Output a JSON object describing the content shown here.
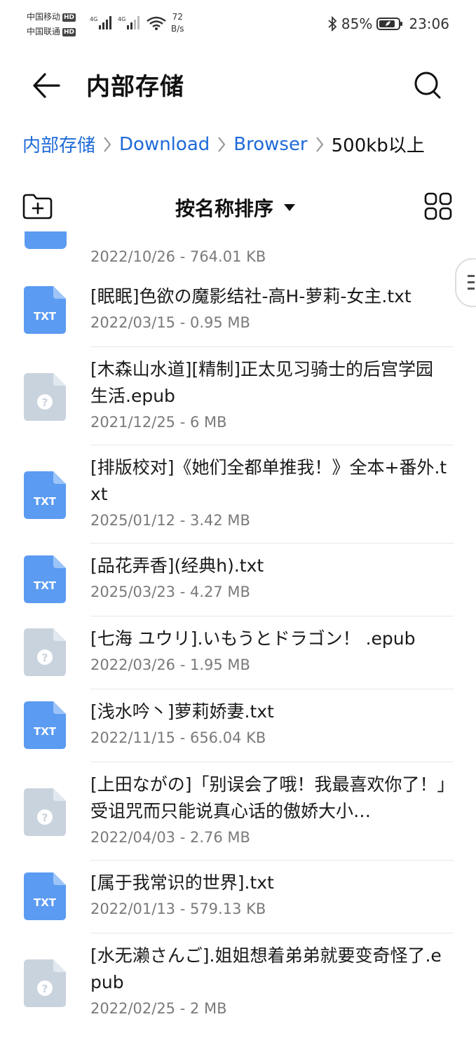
{
  "status_bar": {
    "carrier1": "中国移动",
    "carrier2": "中国联通",
    "hd": "HD",
    "net_type": "4G",
    "speed_value": "72",
    "speed_unit": "B/s",
    "battery_pct": "85%",
    "time": "23:06"
  },
  "header": {
    "title": "内部存储",
    "back_icon": "arrow-left-icon",
    "search_icon": "search-icon"
  },
  "breadcrumb": {
    "items": [
      "内部存储",
      "Download",
      "Browser",
      "500kb以上"
    ]
  },
  "toolbar": {
    "sort_label": "按名称排序",
    "new_folder_icon": "new-folder-icon",
    "view_icon": "grid-view-icon"
  },
  "files": {
    "partial_meta": "2022/10/26 - 764.01 KB",
    "items": [
      {
        "name": "[眠眠]色欲の魔影结社-高H-萝莉-女主.txt",
        "meta": "2022/03/15 - 0.95 MB",
        "type": "TXT"
      },
      {
        "name": "[木森山水道][精制]正太见习骑士的后宫学园生活.epub",
        "meta": "2021/12/25 - 6 MB",
        "type": "unknown"
      },
      {
        "name": "[排版校对]《她们全都单推我！》全本+番外.txt",
        "meta": "2025/01/12 - 3.42 MB",
        "type": "TXT"
      },
      {
        "name": "[品花弄香](经典h).txt",
        "meta": "2025/03/23 - 4.27 MB",
        "type": "TXT"
      },
      {
        "name": "[七海 ユウリ].いもうとドラゴン！ .epub",
        "meta": "2022/03/26 - 1.95 MB",
        "type": "unknown"
      },
      {
        "name": "[浅水吟丶]萝莉娇妻.txt",
        "meta": "2022/11/15 - 656.04 KB",
        "type": "TXT"
      },
      {
        "name": "[上田ながの]「别误会了哦！我最喜欢你了！」受诅咒而只能说真心话的傲娇大小…",
        "meta": "2022/04/03 - 2.76 MB",
        "type": "unknown"
      },
      {
        "name": "[属于我常识的世界].txt",
        "meta": "2022/01/13 - 579.13 KB",
        "type": "TXT"
      },
      {
        "name": "[水无濑さんご].姐姐想着弟弟就要变奇怪了.epub",
        "meta": "2022/02/25 - 2 MB",
        "type": "unknown"
      }
    ]
  },
  "colors": {
    "accent": "#1e6ad8",
    "txt_icon": "#5b9bf2",
    "unknown_icon": "#c9d3de",
    "meta_text": "#7a7a7a"
  }
}
